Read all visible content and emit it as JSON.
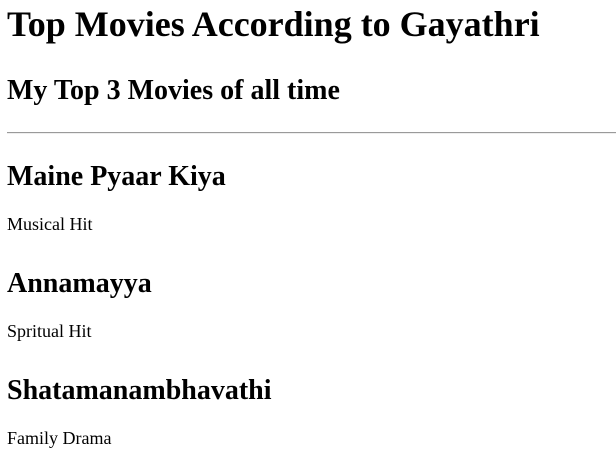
{
  "page": {
    "title": "Top Movies According to Gayathri",
    "subtitle": "My Top 3 Movies of all time"
  },
  "movies": [
    {
      "name": "Maine Pyaar Kiya",
      "description": "Musical Hit"
    },
    {
      "name": "Annamayya",
      "description": "Spritual Hit"
    },
    {
      "name": "Shatamanambhavathi",
      "description": "Family Drama"
    }
  ]
}
